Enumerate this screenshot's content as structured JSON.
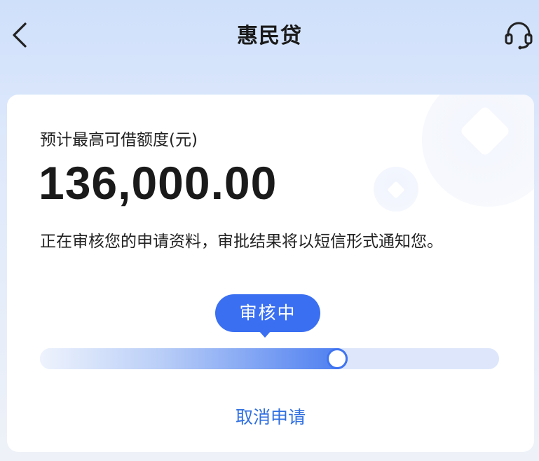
{
  "header": {
    "title": "惠民贷",
    "back_icon": "chevron-left-icon",
    "service_icon": "headset-icon"
  },
  "card": {
    "limit_label": "预计最高可借额度(元)",
    "amount": "136,000.00",
    "notice": "正在审核您的申请资料，审批结果将以短信形式通知您。",
    "status_label": "审核中",
    "progress_fraction": 0.67,
    "cancel_label": "取消申请"
  },
  "colors": {
    "accent": "#3a6ff2",
    "link": "#2f6fe0",
    "track": "#dde6fb",
    "background_top": "#cfe0fb"
  }
}
